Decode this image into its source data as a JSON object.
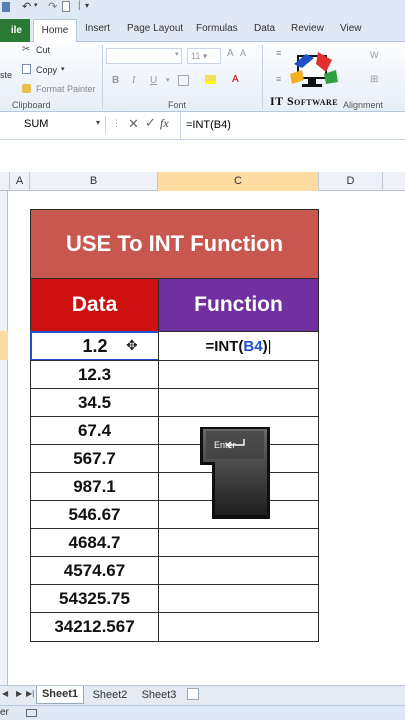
{
  "ribbon": {
    "file_tab": "ile",
    "tabs": [
      "Home",
      "Insert",
      "Page Layout",
      "Formulas",
      "Data",
      "Review",
      "View"
    ],
    "clipboard": {
      "cut": "Cut",
      "copy": "Copy",
      "paste_partial": "ste",
      "format_painter": "Format Painter",
      "label": "Clipboard"
    },
    "font": {
      "size": "11",
      "label": "Font",
      "bold": "B",
      "italic": "I",
      "underline": "U"
    },
    "alignment_label": "Alignment",
    "wrap_partial": "W"
  },
  "logo": {
    "text": "IT Software"
  },
  "formula_bar": {
    "name_box": "SUM",
    "formula": "=INT(B4)"
  },
  "columns": [
    "A",
    "B",
    "C",
    "D"
  ],
  "sheet": {
    "title": "USE To INT Function",
    "header_data": "Data",
    "header_function": "Function",
    "formula_display": {
      "prefix": "=INT(",
      "ref": "B4",
      "suffix": ")"
    },
    "values": [
      "1.2",
      "12.3",
      "34.5",
      "67.4",
      "567.7",
      "987.1",
      "546.67",
      "4684.7",
      "4574.67",
      "54325.75",
      "34212.567"
    ]
  },
  "enter_key": {
    "label": "Enter"
  },
  "sheet_tabs": [
    "Sheet1",
    "Sheet2",
    "Sheet3"
  ],
  "status": {
    "mode_partial": "er"
  },
  "colors": {
    "title_bg": "#c8584f",
    "data_header_bg": "#cc1010",
    "function_header_bg": "#7030a0",
    "ref_blue": "#1f4fc9",
    "file_green": "#2a7a36"
  }
}
